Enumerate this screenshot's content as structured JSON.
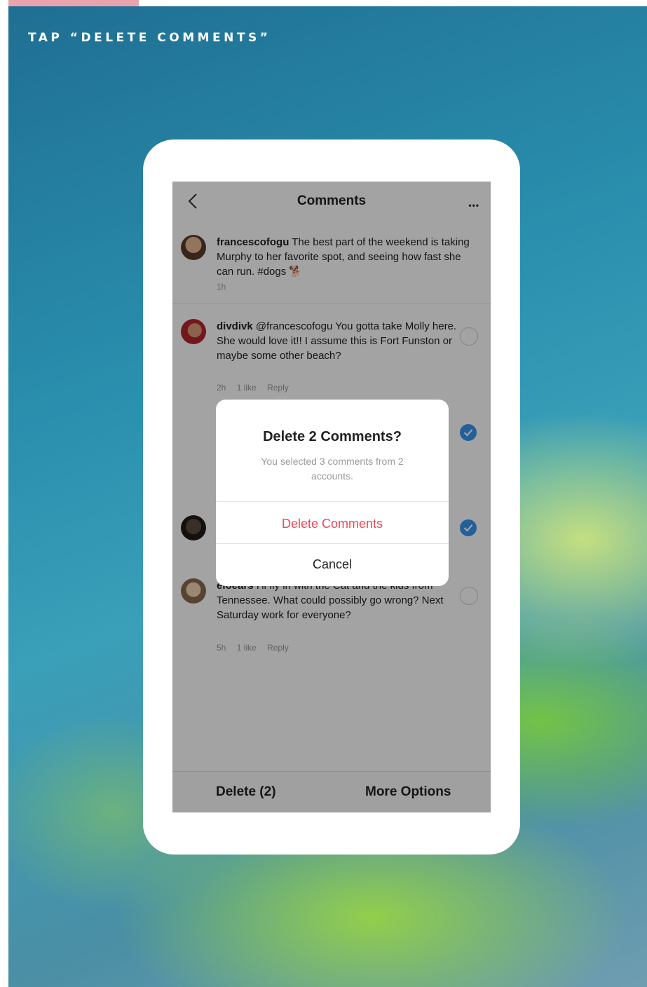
{
  "headline": "TAP “DELETE COMMENTS”",
  "screen": {
    "title": "Comments",
    "back_icon": "chevron-left-icon",
    "more_icon": "more-horizontal-icon",
    "more_label": "•••",
    "comments": [
      {
        "username": "francescofogu",
        "text": "The best part of the weekend is taking Murphy to her favorite spot, and seeing how fast she can run. #dogs 🐕",
        "time": "1h"
      },
      {
        "username": "divdivk",
        "text": "@francescofogu You gotta take Molly here. She would love it!! I assume this is Fort Funston or maybe some other beach?",
        "time": "2h",
        "likes": "1 like",
        "reply": "Reply"
      },
      {
        "username": "eloears",
        "text": "I’ll fly in with the Cat and the kids from Tennessee. What could possibly go wrong? Next Saturday work for everyone?",
        "time": "5h",
        "likes": "1 like",
        "reply": "Reply"
      }
    ],
    "bottom_bar": {
      "delete_label": "Delete (2)",
      "more_options_label": "More Options"
    }
  },
  "dialog": {
    "title": "Delete 2 Comments?",
    "message": "You selected 3 comments from 2 accounts.",
    "delete_label": "Delete Comments",
    "cancel_label": "Cancel"
  },
  "colors": {
    "accent_blue": "#3897f0",
    "destructive_red": "#ed4956",
    "header_pink": "#e9a3ad"
  }
}
